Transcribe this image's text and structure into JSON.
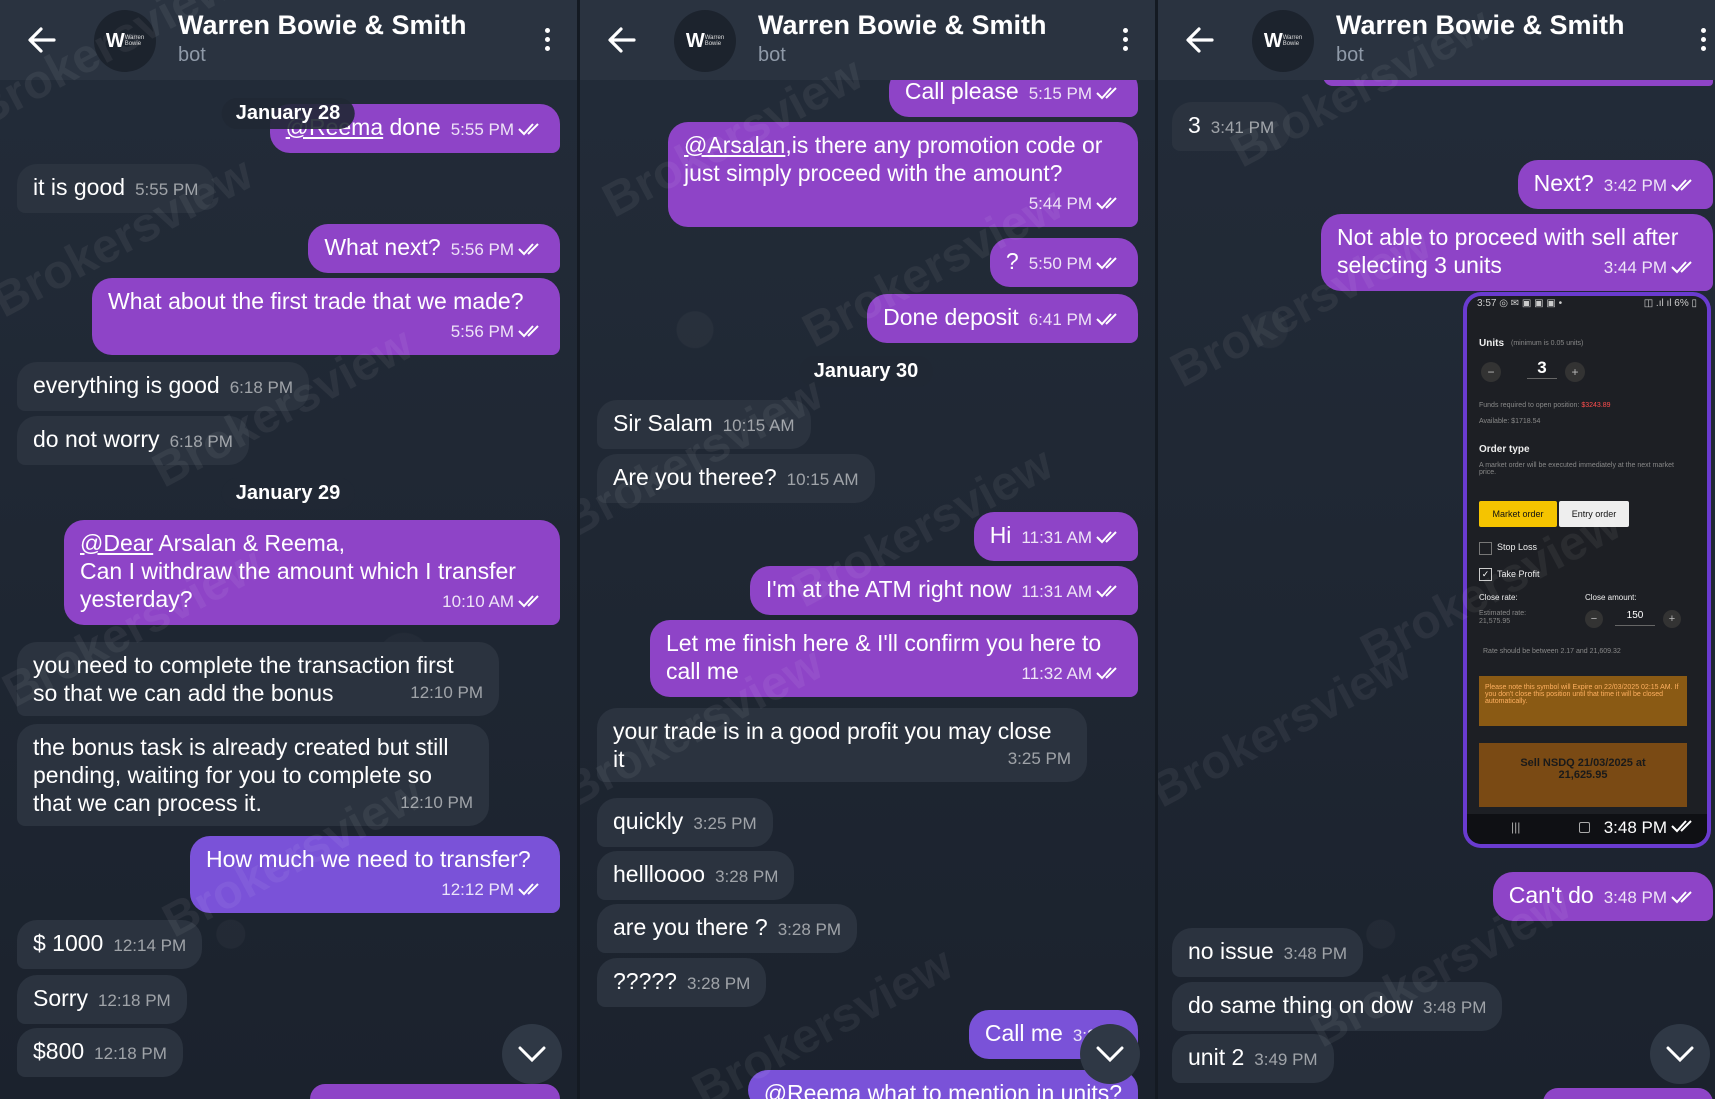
{
  "header": {
    "title": "Warren Bowie & Smith",
    "subtitle": "bot"
  },
  "panel1": {
    "date1": "January 28",
    "date2": "January 29",
    "m1": {
      "mention": "@Reema",
      "text": " done",
      "time": "5:55 PM"
    },
    "m2": {
      "text": "it is good",
      "time": "5:55 PM"
    },
    "m3": {
      "text": "What next?",
      "time": "5:56 PM"
    },
    "m4": {
      "text": "What about the first trade that we made?",
      "time": "5:56 PM"
    },
    "m5": {
      "text": "everything is good",
      "time": "6:18 PM"
    },
    "m6": {
      "text": "do not worry",
      "time": "6:18 PM"
    },
    "m7": {
      "mention": "@Dear",
      "line1": " Arsalan & Reema,",
      "line2": "Can I withdraw the amount which I transfer",
      "line3": "yesterday?",
      "time": "10:10 AM"
    },
    "m8": {
      "line1": "you need to complete the transaction first",
      "line2": "so that we can add the bonus",
      "time": "12:10 PM"
    },
    "m9": {
      "line1": "the bonus task is already created but still",
      "line2": "pending, waiting for you to complete so",
      "line3": "that we can process it.",
      "time": "12:10 PM"
    },
    "m10": {
      "text": "How much we need to transfer?",
      "time": "12:12 PM"
    },
    "m11": {
      "text": "$ 1000",
      "time": "12:14 PM"
    },
    "m12": {
      "text": "Sorry",
      "time": "12:18 PM"
    },
    "m13": {
      "text": "$800",
      "time": "12:18 PM"
    }
  },
  "panel2": {
    "date1": "January 30",
    "m1": {
      "text": "Call please",
      "time": "5:15 PM"
    },
    "m2": {
      "mention": "@Arsalan",
      "line1": ",is there any promotion code or",
      "line2": "just simply proceed with the amount?",
      "time": "5:44 PM"
    },
    "m3": {
      "text": "?",
      "time": "5:50 PM"
    },
    "m4": {
      "text": "Done deposit",
      "time": "6:41 PM"
    },
    "m5": {
      "text": "Sir Salam",
      "time": "10:15 AM"
    },
    "m6": {
      "text": "Are you theree?",
      "time": "10:15 AM"
    },
    "m7": {
      "text": "Hi",
      "time": "11:31 AM"
    },
    "m8": {
      "text": "I'm at the ATM right now",
      "time": "11:31 AM"
    },
    "m9": {
      "line1": "Let me finish here & I'll confirm you here to",
      "line2": "call me",
      "time": "11:32 AM"
    },
    "m10": {
      "line1": "your trade is in a good profit you may close",
      "line2": "it",
      "time": "3:25 PM"
    },
    "m11": {
      "text": "quickly",
      "time": "3:25 PM"
    },
    "m12": {
      "text": "hellloooo",
      "time": "3:28 PM"
    },
    "m13": {
      "text": "are you there ?",
      "time": "3:28 PM"
    },
    "m14": {
      "text": "?????",
      "time": "3:28 PM"
    },
    "m15": {
      "text": "Call me",
      "time": "3:28 P"
    },
    "m16": {
      "text": "@Reema what to mention in units?"
    }
  },
  "panel3": {
    "m1": {
      "text": "3",
      "time": "3:41 PM"
    },
    "m2": {
      "text": "Next?",
      "time": "3:42 PM"
    },
    "m3": {
      "line1": "Not able to proceed with sell after",
      "line2": "selecting 3 units",
      "time": "3:44 PM"
    },
    "shot": {
      "status": "3:57 ◎ ✉ ▣ ▣ ▣ •",
      "battery": "◫ .ıl ıl 6% ▯",
      "units_label": "Units",
      "units_hint": "(minimum is 0.05 units)",
      "units_value": "3",
      "funds": "Funds required to open position:",
      "funds_val": "$3243.89",
      "available": "Available: $1718.54",
      "order_type": "Order type",
      "order_desc": "A market order will be executed immediately at the next market price.",
      "market": "Market order",
      "entry": "Entry order",
      "stop_loss": "Stop Loss",
      "take_profit": "Take Profit",
      "close_rate": "Close rate:",
      "close_amount": "Close amount:",
      "est_rate": "Estimated rate:",
      "est_val": "21,575.95",
      "amount": "150",
      "range": "Rate should be between 2.17 and 21,609.32",
      "warning": "Please note this symbol will Expire on 22/03/2025 02:15 AM. If you don't close this position until that time it will be closed automatically.",
      "sell1": "Sell NSDQ 21/03/2025 at",
      "sell2": "21,625.95",
      "time": "3:48 PM"
    },
    "m4": {
      "text": "Can't do",
      "time": "3:48 PM"
    },
    "m5": {
      "text": "no issue",
      "time": "3:48 PM"
    },
    "m6": {
      "text": "do same thing on dow",
      "time": "3:48 PM"
    },
    "m7": {
      "text": "unit 2",
      "time": "3:49 PM"
    }
  },
  "watermark": "Brokersview",
  "colors": {
    "outgoing": "#8e44c7",
    "incoming": "#2b333f",
    "header": "#2a3340"
  }
}
